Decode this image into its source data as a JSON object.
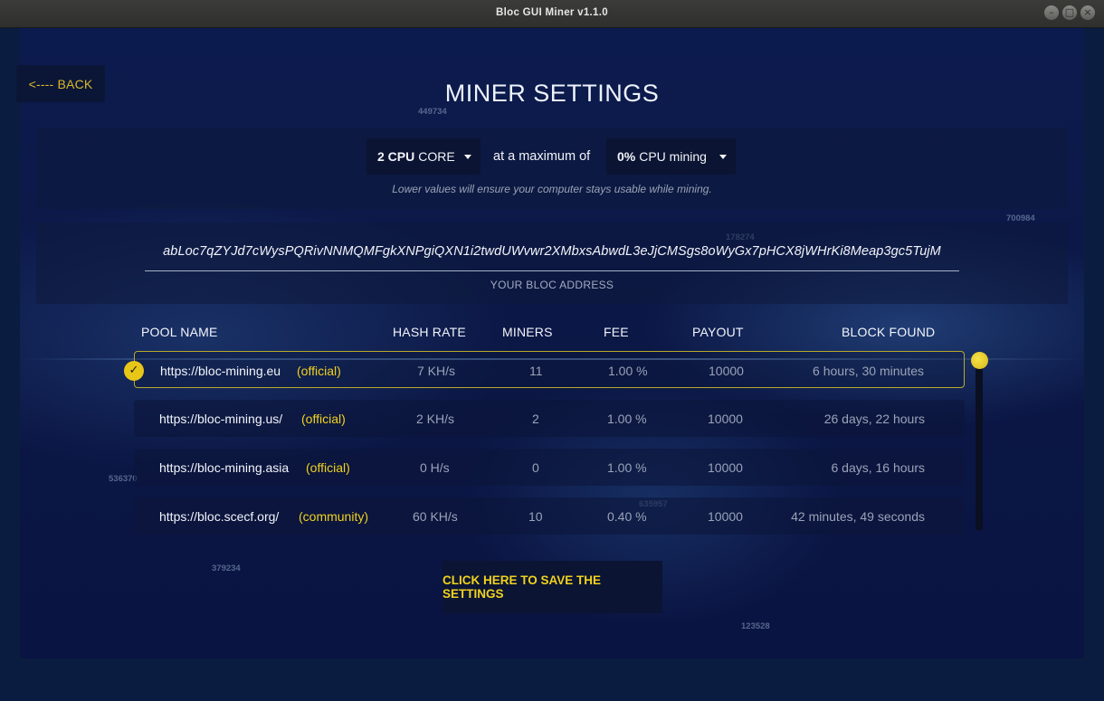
{
  "window": {
    "title": "Bloc GUI Miner v1.1.0",
    "controls": {
      "minimize": "–",
      "maximize": "□",
      "close": "×"
    }
  },
  "nav": {
    "back_label": "<---- BACK"
  },
  "page_title": "MINER SETTINGS",
  "cpu": {
    "cores_value": "2 CPU",
    "cores_unit": "CORE",
    "connector_text": "at a maximum of",
    "usage_value": "0%",
    "usage_unit": "CPU mining",
    "hint": "Lower values will ensure your computer stays usable while mining."
  },
  "address": {
    "value": "abLoc7qZYJd7cWysPQRivNNMQMFgkXNPgiQXN1i2twdUWvwr2XMbxsAbwdL3eJjCMSgs8oWyGx7pHCX8jWHrKi8Meap3gc5TujM",
    "label": "YOUR BLOC ADDRESS"
  },
  "table": {
    "headers": [
      "POOL NAME",
      "HASH RATE",
      "MINERS",
      "FEE",
      "PAYOUT",
      "BLOCK FOUND"
    ],
    "rows": [
      {
        "pool": "https://bloc-mining.eu",
        "tag": "(official)",
        "hash_rate": "7 KH/s",
        "miners": "11",
        "fee": "1.00 %",
        "payout": "10000",
        "block_found": "6 hours, 30 minutes",
        "selected": true
      },
      {
        "pool": "https://bloc-mining.us/",
        "tag": "(official)",
        "hash_rate": "2 KH/s",
        "miners": "2",
        "fee": "1.00 %",
        "payout": "10000",
        "block_found": "26 days, 22 hours",
        "selected": false
      },
      {
        "pool": "https://bloc-mining.asia",
        "tag": "(official)",
        "hash_rate": "0 H/s",
        "miners": "0",
        "fee": "1.00 %",
        "payout": "10000",
        "block_found": "6 days, 16 hours",
        "selected": false
      },
      {
        "pool": "https://bloc.scecf.org/",
        "tag": "(community)",
        "hash_rate": "60 KH/s",
        "miners": "10",
        "fee": "0.40 %",
        "payout": "10000",
        "block_found": "42 minutes, 49 seconds",
        "selected": false
      }
    ]
  },
  "selected_icon": "checkmark-icon",
  "save_label": "CLICK HERE TO SAVE THE SETTINGS",
  "background_numbers": [
    "449734",
    "700984",
    "536370",
    "635957",
    "379234",
    "123528",
    "178274"
  ],
  "colors": {
    "accent": "#f0d21e",
    "background": "#0b1745",
    "text": "#f2f4fa"
  }
}
